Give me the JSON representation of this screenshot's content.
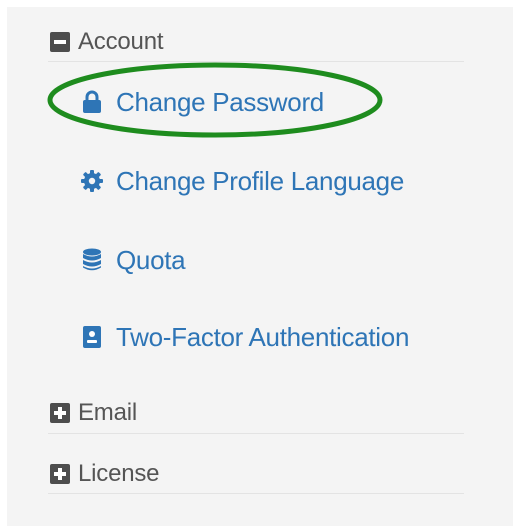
{
  "sections": [
    {
      "label": "Account",
      "state": "expanded",
      "toggle_icon": "minus-square-icon"
    },
    {
      "label": "Email",
      "state": "collapsed",
      "toggle_icon": "plus-square-icon"
    },
    {
      "label": "License",
      "state": "collapsed",
      "toggle_icon": "plus-square-icon"
    }
  ],
  "account_items": [
    {
      "label": "Change Password",
      "icon": "lock-icon",
      "highlighted": true
    },
    {
      "label": "Change Profile Language",
      "icon": "gear-icon"
    },
    {
      "label": "Quota",
      "icon": "database-icon"
    },
    {
      "label": "Two-Factor Authentication",
      "icon": "id-badge-icon"
    }
  ],
  "colors": {
    "link": "#2e75b6",
    "header_text": "#555555",
    "toggle_bg": "#4d4d4d",
    "panel_bg": "#f4f4f4",
    "highlight": "#1e8c1e"
  }
}
